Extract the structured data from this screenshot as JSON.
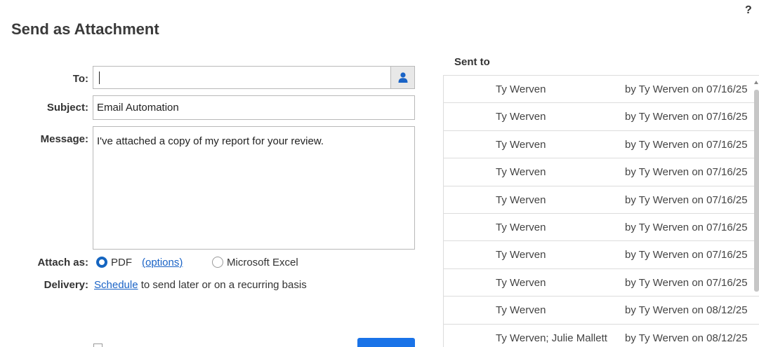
{
  "header": {
    "title": "Send as Attachment",
    "help": "?"
  },
  "form": {
    "to_label": "To:",
    "to_value": "",
    "subject_label": "Subject:",
    "subject_value": "Email Automation",
    "message_label": "Message:",
    "message_value": "I've attached a copy of my report for your review.",
    "attach_label": "Attach as:",
    "attach_options": [
      {
        "label": "PDF",
        "selected": true
      },
      {
        "label": "Microsoft Excel",
        "selected": false
      }
    ],
    "pdf_options_link": "(options)",
    "delivery_label": "Delivery:",
    "schedule_link": "Schedule",
    "delivery_text": "to send later or on a recurring basis"
  },
  "sent_to": {
    "title": "Sent to",
    "rows": [
      {
        "recipients": "Ty Werven",
        "sent_by": "by Ty Werven on 07/16/25"
      },
      {
        "recipients": "Ty Werven",
        "sent_by": "by Ty Werven on 07/16/25"
      },
      {
        "recipients": "Ty Werven",
        "sent_by": "by Ty Werven on 07/16/25"
      },
      {
        "recipients": "Ty Werven",
        "sent_by": "by Ty Werven on 07/16/25"
      },
      {
        "recipients": "Ty Werven",
        "sent_by": "by Ty Werven on 07/16/25"
      },
      {
        "recipients": "Ty Werven",
        "sent_by": "by Ty Werven on 07/16/25"
      },
      {
        "recipients": "Ty Werven",
        "sent_by": "by Ty Werven on 07/16/25"
      },
      {
        "recipients": "Ty Werven",
        "sent_by": "by Ty Werven on 07/16/25"
      },
      {
        "recipients": "Ty Werven",
        "sent_by": "by Ty Werven on 08/12/25"
      },
      {
        "recipients": "Ty Werven; Julie Mallett",
        "sent_by": "by Ty Werven on 08/12/25"
      }
    ]
  },
  "colors": {
    "accent": "#1a73e8",
    "link": "#1a63c6",
    "border": "#b9b9b9"
  },
  "icons": {
    "contact": "person-icon",
    "help": "help-icon"
  }
}
